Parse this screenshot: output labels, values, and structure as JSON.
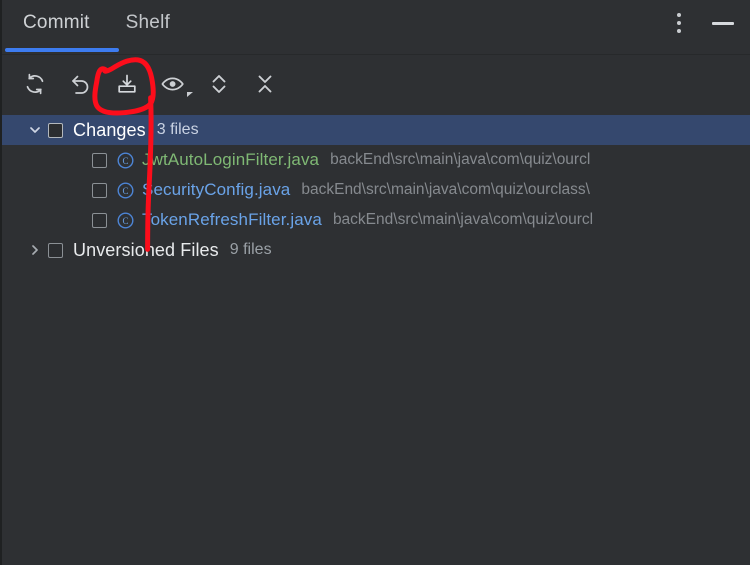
{
  "window": {
    "background_color": "#2e3033",
    "accent_color": "#3d7cf0",
    "selection_color": "#35486e",
    "annotation_color": "#fc0d1b"
  },
  "tabs": [
    {
      "label": "Commit",
      "active": true
    },
    {
      "label": "Shelf",
      "active": false
    }
  ],
  "window_controls": {
    "options_icon": "more-vertical-icon",
    "minimize_icon": "minimize-icon"
  },
  "toolbar": {
    "buttons": [
      {
        "name": "refresh-button",
        "icon": "refresh-icon",
        "tooltip": "Refresh"
      },
      {
        "name": "rollback-button",
        "icon": "rollback-arrow-icon",
        "tooltip": "Rollback"
      },
      {
        "name": "update-project-button",
        "icon": "download-tray-icon",
        "tooltip": "Update Project",
        "annotated": true
      },
      {
        "name": "show-diff-button",
        "icon": "eye-icon",
        "tooltip": "Preview Diff",
        "has_dropdown": true
      },
      {
        "name": "expand-all-button",
        "icon": "chevron-expand-icon",
        "tooltip": "Expand All"
      },
      {
        "name": "collapse-all-button",
        "icon": "chevron-collapse-icon",
        "tooltip": "Collapse All"
      }
    ]
  },
  "tree": {
    "groups": [
      {
        "label": "Changes",
        "count": "3 files",
        "expanded": true,
        "selected": true,
        "checked": false,
        "twisty_icon": "chevron-down-icon",
        "files": [
          {
            "name": "JwtAutoLoginFilter.java",
            "path": "backEnd\\src\\main\\java\\com\\quiz\\ourcl",
            "status": "added",
            "icon": "java-class-icon",
            "checked": false
          },
          {
            "name": "SecurityConfig.java",
            "path": "backEnd\\src\\main\\java\\com\\quiz\\ourclass\\",
            "status": "modified",
            "icon": "java-class-icon",
            "checked": false
          },
          {
            "name": "TokenRefreshFilter.java",
            "path": "backEnd\\src\\main\\java\\com\\quiz\\ourcl",
            "status": "modified",
            "icon": "java-class-icon",
            "checked": false
          }
        ]
      },
      {
        "label": "Unversioned Files",
        "count": "9 files",
        "expanded": false,
        "selected": false,
        "checked": false,
        "twisty_icon": "chevron-right-icon",
        "files": []
      }
    ]
  },
  "annotation": {
    "type": "freehand-marker",
    "color": "#fc0d1b",
    "shapes": [
      {
        "kind": "circle-around",
        "target": "update-project-button"
      },
      {
        "kind": "pointer-line",
        "from_target": "update-project-button",
        "direction": "down"
      }
    ]
  }
}
